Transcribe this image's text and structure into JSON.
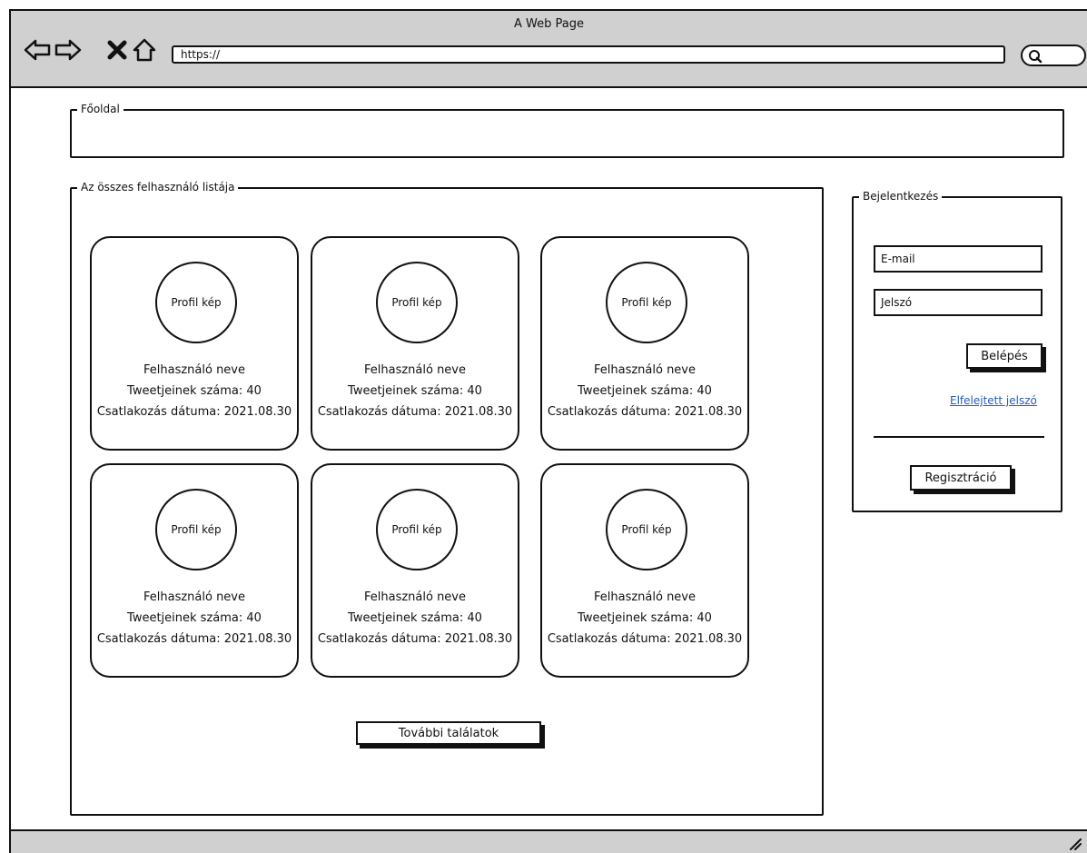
{
  "window": {
    "title": "A Web Page"
  },
  "browser": {
    "url": "https://"
  },
  "home": {
    "legend": "Főoldal"
  },
  "users_list": {
    "legend": "Az összes felhasználó listája",
    "cards": [
      {
        "avatar": "Profil kép",
        "name": "Felhasználó neve",
        "tweets": "Tweetjeinek száma: 40",
        "joined": "Csatlakozás dátuma: 2021.08.30"
      },
      {
        "avatar": "Profil kép",
        "name": "Felhasználó neve",
        "tweets": "Tweetjeinek száma: 40",
        "joined": "Csatlakozás dátuma: 2021.08.30"
      },
      {
        "avatar": "Profil kép",
        "name": "Felhasználó neve",
        "tweets": "Tweetjeinek száma: 40",
        "joined": "Csatlakozás dátuma: 2021.08.30"
      },
      {
        "avatar": "Profil kép",
        "name": "Felhasználó neve",
        "tweets": "Tweetjeinek száma: 40",
        "joined": "Csatlakozás dátuma: 2021.08.30"
      },
      {
        "avatar": "Profil kép",
        "name": "Felhasználó neve",
        "tweets": "Tweetjeinek száma: 40",
        "joined": "Csatlakozás dátuma: 2021.08.30"
      },
      {
        "avatar": "Profil kép",
        "name": "Felhasználó neve",
        "tweets": "Tweetjeinek száma: 40",
        "joined": "Csatlakozás dátuma: 2021.08.30"
      }
    ],
    "more_button": "További találatok"
  },
  "login": {
    "legend": "Bejelentkezés",
    "email_value": "E-mail",
    "password_value": "Jelszó",
    "login_button": "Belépés",
    "forgot_link": "Elfelejtett jelszó",
    "register_button": "Regisztráció"
  },
  "icons": [
    "back-arrow-icon",
    "forward-arrow-icon",
    "stop-x-icon",
    "home-icon",
    "search-icon",
    "resize-grip-icon"
  ]
}
